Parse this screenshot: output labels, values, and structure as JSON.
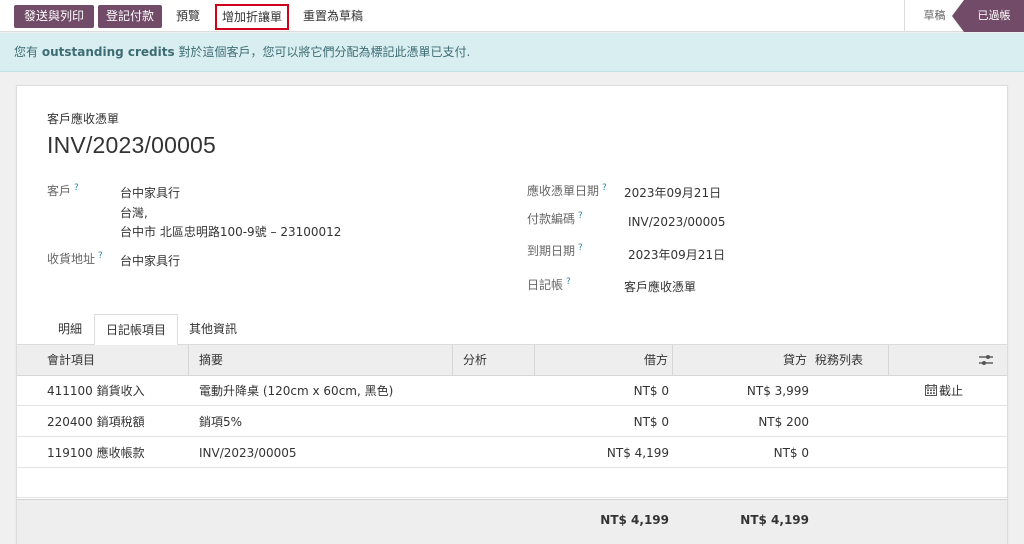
{
  "toolbar": {
    "send_print": "發送與列印",
    "register_payment": "登記付款",
    "preview": "預覽",
    "add_credit_note": "增加折讓單",
    "reset_to_draft": "重置為草稿"
  },
  "status": {
    "draft": "草稿",
    "posted": "已過帳"
  },
  "alert": {
    "prefix": "您有 ",
    "bold": "outstanding credits",
    "suffix": " 對於這個客戶，您可以將它們分配為標記此憑單已支付."
  },
  "document": {
    "type": "客戶應收憑單",
    "name": "INV/2023/00005"
  },
  "fields": {
    "customer_label": "客戶",
    "customer_name": "台中家具行",
    "customer_country": "台灣,",
    "customer_address": "台中市 北區忠明路100-9號 – 23100012",
    "delivery_label": "收貨地址",
    "delivery_value": "台中家具行",
    "invoice_date_label": "應收憑單日期",
    "invoice_date_value": "2023年09月21日",
    "payment_ref_label": "付款編碼",
    "payment_ref_value": "INV/2023/00005",
    "due_date_label": "到期日期",
    "due_date_value": "2023年09月21日",
    "journal_label": "日記帳",
    "journal_value": "客戶應收憑單",
    "help_mark": "?"
  },
  "tabs": [
    "明細",
    "日記帳項目",
    "其他資訊"
  ],
  "table": {
    "headers": {
      "account": "會計項目",
      "label": "摘要",
      "analytic": "分析",
      "debit": "借方",
      "credit": "貸方",
      "taxes": "稅務列表"
    },
    "rows": [
      {
        "account": "411100 銷貨收入",
        "label": "電動升降桌 (120cm x 60cm, 黑色)",
        "debit": "NT$ 0",
        "credit": "NT$ 3,999",
        "cutoff": "截止"
      },
      {
        "account": "220400 銷項稅額",
        "label": "銷項5%",
        "debit": "NT$ 0",
        "credit": "NT$ 200",
        "cutoff": ""
      },
      {
        "account": "119100 應收帳款",
        "label": "INV/2023/00005",
        "debit": "NT$ 4,199",
        "credit": "NT$ 0",
        "cutoff": ""
      }
    ],
    "totals": {
      "debit": "NT$ 4,199",
      "credit": "NT$ 4,199"
    }
  },
  "colors": {
    "brand": "#714b67",
    "alert_bg": "#d9eef1",
    "highlight_border": "#d0021b"
  }
}
